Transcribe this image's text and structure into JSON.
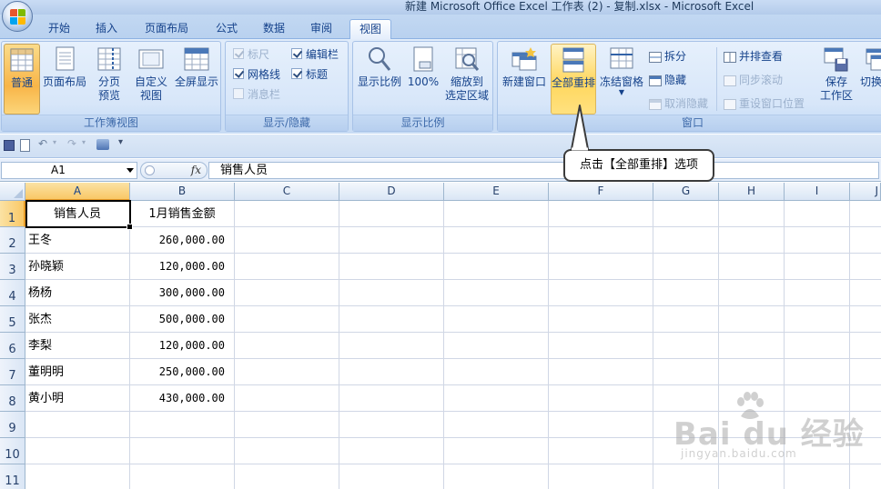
{
  "window": {
    "title": "新建 Microsoft Office Excel 工作表 (2) - 复制.xlsx - Microsoft Excel"
  },
  "tabs": [
    {
      "label": "开始"
    },
    {
      "label": "插入"
    },
    {
      "label": "页面布局"
    },
    {
      "label": "公式"
    },
    {
      "label": "数据"
    },
    {
      "label": "审阅"
    },
    {
      "label": "视图",
      "active": true
    }
  ],
  "ribbon": {
    "workbook_views": {
      "label": "工作簿视图",
      "normal": "普通",
      "page_layout": "页面布局",
      "page_break_1": "分页",
      "page_break_2": "预览",
      "custom_1": "自定义",
      "custom_2": "视图",
      "fullscreen": "全屏显示"
    },
    "show_hide": {
      "label": "显示/隐藏",
      "ruler": "标尺",
      "gridlines": "网格线",
      "message_bar": "消息栏",
      "formula_bar": "编辑栏",
      "headings": "标题"
    },
    "zoom": {
      "label": "显示比例",
      "zoom": "显示比例",
      "hundred": "100%",
      "zoom_sel_1": "缩放到",
      "zoom_sel_2": "选定区域"
    },
    "window": {
      "label": "窗口",
      "new_window": "新建窗口",
      "arrange_all": "全部重排",
      "freeze": "冻结窗格",
      "split": "拆分",
      "hide": "隐藏",
      "unhide": "取消隐藏",
      "side_by_side": "并排查看",
      "sync_scroll": "同步滚动",
      "reset_pos": "重设窗口位置",
      "save_ws_1": "保存",
      "save_ws_2": "工作区",
      "switch": "切换窗"
    }
  },
  "formula_bar": {
    "name_box": "A1",
    "fx": "fx",
    "content": "销售人员"
  },
  "columns": [
    "A",
    "B",
    "C",
    "D",
    "E",
    "F",
    "G",
    "H",
    "I",
    "J"
  ],
  "rows": [
    "1",
    "2",
    "3",
    "4",
    "5",
    "6",
    "7",
    "8",
    "9",
    "10",
    "11"
  ],
  "table": {
    "header": [
      "销售人员",
      "1月销售金额"
    ],
    "records": [
      [
        "王冬",
        "260,000.00"
      ],
      [
        "孙晓颖",
        "120,000.00"
      ],
      [
        "杨杨",
        "300,000.00"
      ],
      [
        "张杰",
        "500,000.00"
      ],
      [
        "李梨",
        "120,000.00"
      ],
      [
        "董明明",
        "250,000.00"
      ],
      [
        "黄小明",
        "430,000.00"
      ]
    ]
  },
  "callout": {
    "text": "点击【全部重排】选项"
  },
  "watermark": {
    "brand": "Bai du 经验",
    "url": "jingyan.baidu.com"
  },
  "colors": {
    "accent": "#15428b",
    "selected_header": "#f9c866"
  }
}
